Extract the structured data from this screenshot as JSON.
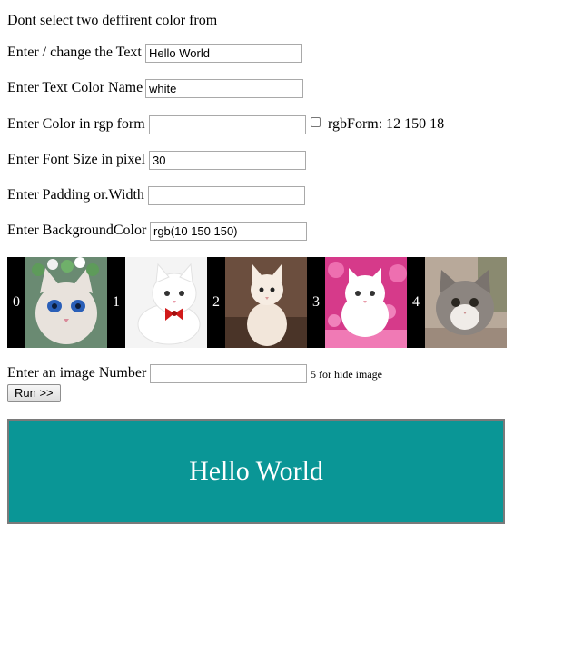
{
  "header": {
    "note": "Dont select two deffirent color from"
  },
  "form": {
    "text": {
      "label": "Enter / change the Text",
      "value": "Hello World"
    },
    "text_color": {
      "label": "Enter Text Color Name",
      "value": "white"
    },
    "rgb_color": {
      "label": "Enter Color in rgp form",
      "value": "",
      "checkbox_label": "rgbForm: 12 150 18"
    },
    "font_size": {
      "label": "Enter Font Size in pixel",
      "value": "30"
    },
    "padding": {
      "label": "Enter Padding or.Width",
      "value": ""
    },
    "background": {
      "label": "Enter BackgroundColor",
      "value": "rgb(10 150 150)"
    },
    "image_number": {
      "label": "Enter an image Number",
      "value": "",
      "hint": "5 for hide image"
    },
    "run_button": "Run >>"
  },
  "images": {
    "numbers": [
      "0",
      "1",
      "2",
      "3",
      "4"
    ],
    "icons": [
      "cat-image-0",
      "cat-image-1",
      "cat-image-2",
      "cat-image-3",
      "cat-image-4"
    ]
  },
  "output": {
    "text": "Hello World",
    "text_color": "#ffffff",
    "font_size_px": 30,
    "background_color": "rgb(10 150 150)"
  },
  "colors": {
    "output_background": "#0a9696",
    "output_border": "#7a7a7a",
    "image_strip_background": "#000000"
  }
}
